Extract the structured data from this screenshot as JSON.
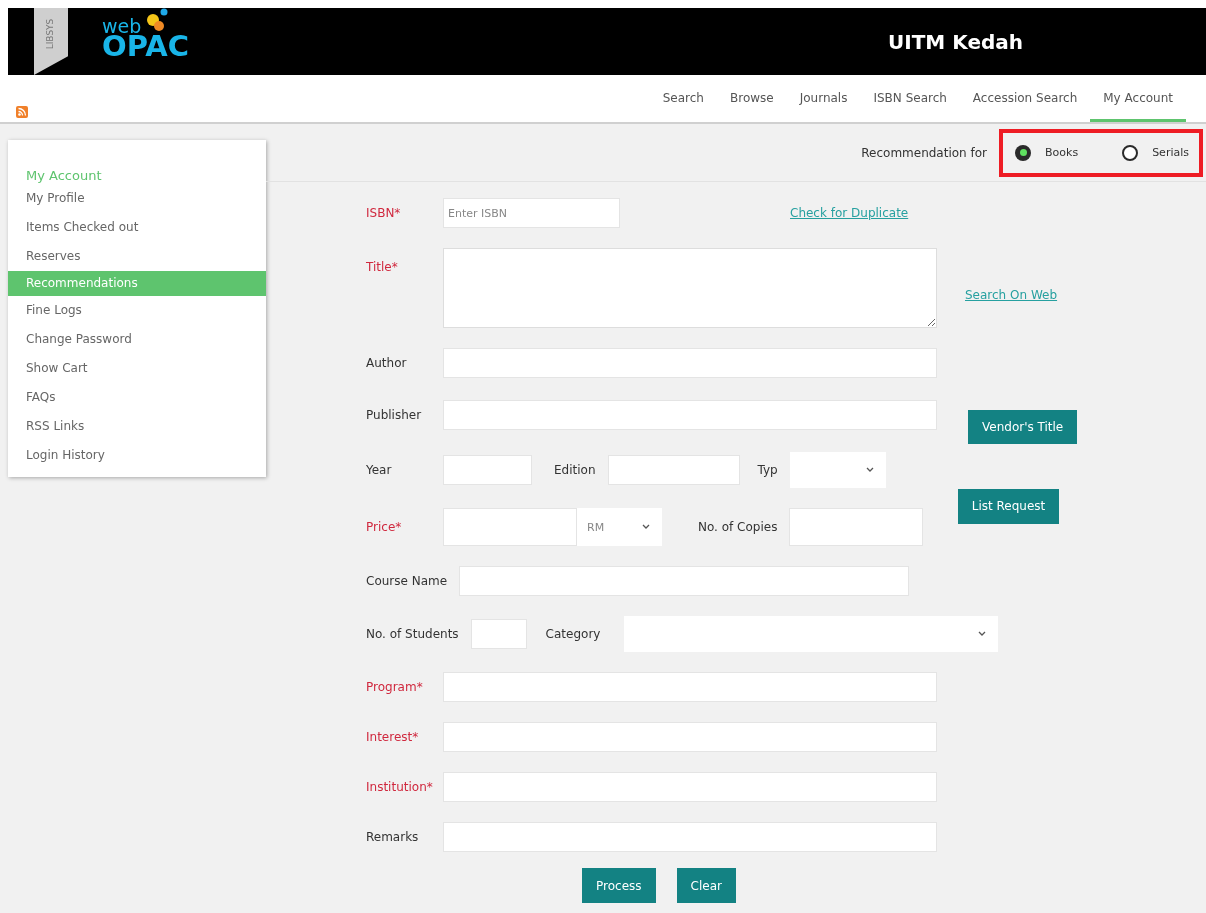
{
  "header": {
    "brand_tag": "LIBSYS",
    "logo_small": "web",
    "logo_large": "OPAC",
    "library": "UITM Kedah"
  },
  "nav": [
    {
      "label": "Search",
      "selected": false
    },
    {
      "label": "Browse",
      "selected": false
    },
    {
      "label": "Journals",
      "selected": false
    },
    {
      "label": "ISBN Search",
      "selected": false
    },
    {
      "label": "Accession Search",
      "selected": false
    },
    {
      "label": "My Account",
      "selected": true
    }
  ],
  "sidebar": {
    "heading": "My Account",
    "items": [
      {
        "label": "My Profile",
        "selected": false
      },
      {
        "label": "Items Checked out",
        "selected": false
      },
      {
        "label": "Reserves",
        "selected": false
      },
      {
        "label": "Recommendations",
        "selected": true
      },
      {
        "label": "Fine Logs",
        "selected": false
      },
      {
        "label": "Change Password",
        "selected": false
      },
      {
        "label": "Show Cart",
        "selected": false
      },
      {
        "label": "FAQs",
        "selected": false
      },
      {
        "label": "RSS Links",
        "selected": false
      },
      {
        "label": "Login History",
        "selected": false
      }
    ]
  },
  "recommendation": {
    "label": "Recommendation for",
    "options": [
      {
        "label": "Books",
        "selected": true
      },
      {
        "label": "Serials",
        "selected": false
      }
    ]
  },
  "form": {
    "isbn": {
      "label": "ISBN*",
      "required": true,
      "placeholder": "Enter ISBN"
    },
    "duplicate_link": "Check for Duplicate",
    "title": {
      "label": "Title*",
      "required": true
    },
    "web_link": "Search On Web",
    "author": {
      "label": "Author",
      "required": false
    },
    "publisher": {
      "label": "Publisher",
      "required": false
    },
    "vendor_button": "Vendor's Title",
    "year": {
      "label": "Year",
      "required": false
    },
    "edition": {
      "label": "Edition",
      "required": false
    },
    "type": {
      "label": "Typ",
      "required": false
    },
    "list_button": "List Request",
    "price": {
      "label": "Price*",
      "required": true,
      "currency": "RM"
    },
    "copies": {
      "label": "No. of Copies",
      "required": false
    },
    "course": {
      "label": "Course Name",
      "required": false
    },
    "students": {
      "label": "No. of Students",
      "required": false
    },
    "category": {
      "label": "Category",
      "required": false
    },
    "program": {
      "label": "Program*",
      "required": true
    },
    "interest": {
      "label": "Interest*",
      "required": true
    },
    "institution": {
      "label": "Institution*",
      "required": true
    },
    "remarks": {
      "label": "Remarks",
      "required": false
    },
    "process_button": "Process",
    "clear_button": "Clear"
  }
}
